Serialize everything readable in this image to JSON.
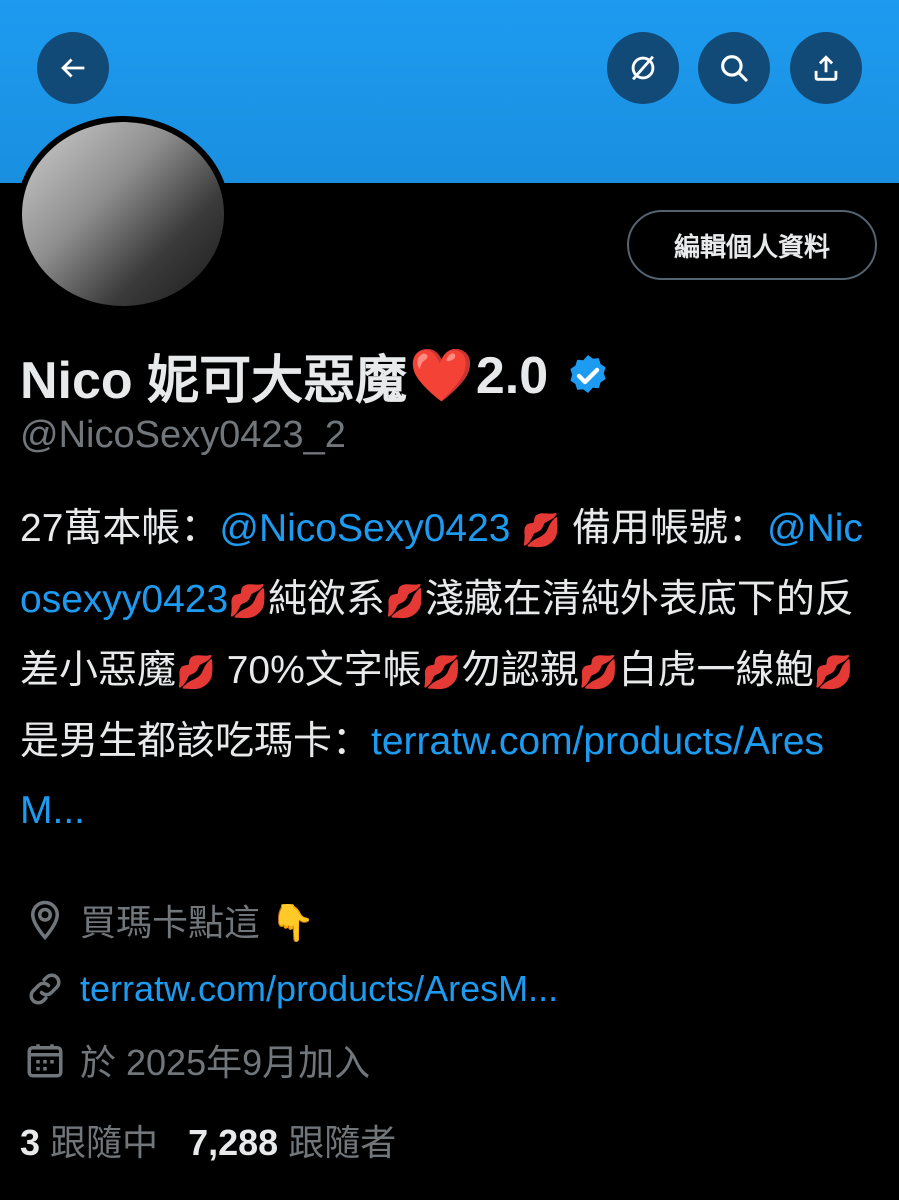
{
  "colors": {
    "accent": "#1d9bf0",
    "background": "#000000",
    "text": "#e7e9ea",
    "secondary": "#71767b",
    "banner": "#1d9bf0"
  },
  "header": {
    "back_icon": "arrow-left-icon",
    "hide_icon": "eye-slash-icon",
    "search_icon": "search-icon",
    "share_icon": "share-icon"
  },
  "profile": {
    "edit_label": "編輯個人資料",
    "name_prefix": "Nico 妮可大惡魔",
    "name_heart": "❤️",
    "name_suffix": "2.0",
    "handle": "@NicoSexy0423_2"
  },
  "bio": {
    "t1": "27萬本帳：",
    "l1": "@NicoSexy0423",
    "t2": " 備用帳號：",
    "l2": "@Nicosexyy0423",
    "t3": "純欲系",
    "t4": "淺藏在清純外表底下的反差小惡魔",
    "t5": " 70%文字帳",
    "t6": "勿認親",
    "t7": "白虎一線鮑",
    "t8": "是男生都該吃瑪卡：",
    "l3": "terratw.com/products/AresM...",
    "kiss": "💋"
  },
  "meta": {
    "location": "買瑪卡點這 👇",
    "website": "terratw.com/products/AresM...",
    "joined": "於 2025年9月加入"
  },
  "stats": {
    "following_count": "3",
    "following_label": "跟隨中",
    "followers_count": "7,288",
    "followers_label": "跟隨者"
  }
}
